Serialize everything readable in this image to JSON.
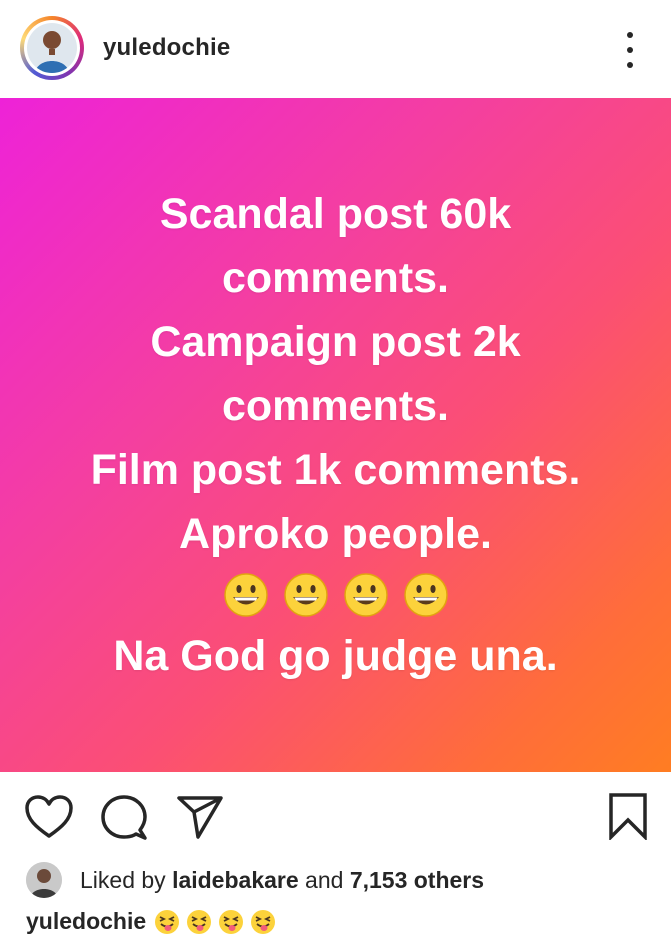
{
  "header": {
    "username": "yuledochie",
    "avatar_icon": "profile-avatar",
    "more_icon": "more-options-icon"
  },
  "post": {
    "lines": [
      "Scandal post 60k",
      "comments.",
      "Campaign post 2k",
      "comments.",
      "Film post 1k comments.",
      "Aproko people."
    ],
    "emoji_count": 4,
    "emoji_name": "grinning-face",
    "last_line": "Na God go judge una.",
    "colors": {
      "gradient_start": "#ee22d8",
      "gradient_end": "#ff7d22",
      "text": "#ffffff"
    }
  },
  "actions": {
    "like_icon": "heart-icon",
    "comment_icon": "comment-icon",
    "share_icon": "send-icon",
    "save_icon": "bookmark-icon"
  },
  "likes": {
    "prefix": "Liked by",
    "user": "laidebakare",
    "and": "and",
    "others": "7,153 others"
  },
  "caption": {
    "username": "yuledochie",
    "emoji_count": 4,
    "emoji_name": "squinting-tongue-face"
  }
}
